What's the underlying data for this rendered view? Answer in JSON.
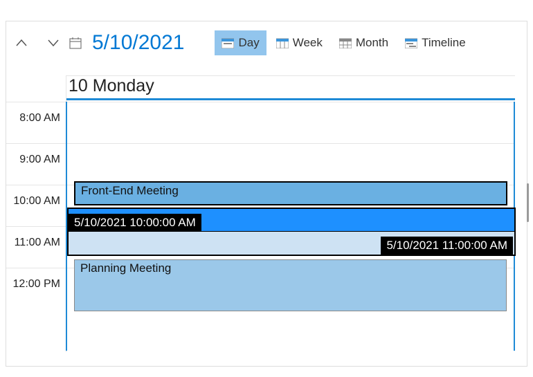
{
  "toolbar": {
    "date": "5/10/2021",
    "views": {
      "day": "Day",
      "week": "Week",
      "month": "Month",
      "timeline": "Timeline"
    }
  },
  "dayHeader": "10 Monday",
  "hours": {
    "h8": "8:00 AM",
    "h9": "9:00 AM",
    "h10": "10:00 AM",
    "h11": "11:00 AM",
    "h12": "12:00 PM"
  },
  "events": {
    "frontend": {
      "title": "Front-End Meeting"
    },
    "planning": {
      "title": "Planning Meeting"
    },
    "newSlot": {
      "startTip": "5/10/2021 10:00:00 AM",
      "endTip": "5/10/2021 11:00:00 AM"
    }
  }
}
